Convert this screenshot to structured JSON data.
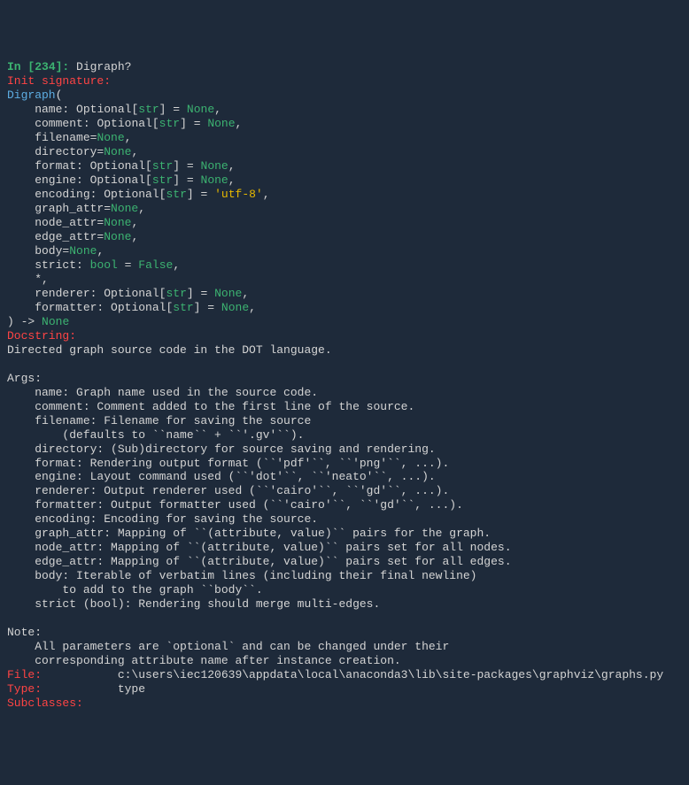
{
  "prompt": {
    "label": "In [",
    "number": "234",
    "close": "]: ",
    "query": "Digraph?"
  },
  "init_sig_label": "Init signature:",
  "signature": {
    "classname": "Digraph",
    "open": "(",
    "params": [
      {
        "raw": "    name: Optional[str] = None,"
      },
      {
        "raw": "    comment: Optional[str] = None,"
      },
      {
        "raw": "    filename=None,"
      },
      {
        "raw": "    directory=None,"
      },
      {
        "raw": "    format: Optional[str] = None,"
      },
      {
        "raw": "    engine: Optional[str] = None,"
      },
      {
        "raw": "    encoding: Optional[str] = 'utf-8',"
      },
      {
        "raw": "    graph_attr=None,"
      },
      {
        "raw": "    node_attr=None,"
      },
      {
        "raw": "    edge_attr=None,"
      },
      {
        "raw": "    body=None,"
      },
      {
        "raw": "    strict: bool = False,"
      },
      {
        "raw": "    *,"
      },
      {
        "raw": "    renderer: Optional[str] = None,"
      },
      {
        "raw": "    formatter: Optional[str] = None,"
      }
    ],
    "close": ") -> None"
  },
  "docstring_label": "Docstring:",
  "docstring_body": "Directed graph source code in the DOT language.\n\nArgs:\n    name: Graph name used in the source code.\n    comment: Comment added to the first line of the source.\n    filename: Filename for saving the source\n        (defaults to ``name`` + ``'.gv'``).\n    directory: (Sub)directory for source saving and rendering.\n    format: Rendering output format (``'pdf'``, ``'png'``, ...).\n    engine: Layout command used (``'dot'``, ``'neato'``, ...).\n    renderer: Output renderer used (``'cairo'``, ``'gd'``, ...).\n    formatter: Output formatter used (``'cairo'``, ``'gd'``, ...).\n    encoding: Encoding for saving the source.\n    graph_attr: Mapping of ``(attribute, value)`` pairs for the graph.\n    node_attr: Mapping of ``(attribute, value)`` pairs set for all nodes.\n    edge_attr: Mapping of ``(attribute, value)`` pairs set for all edges.\n    body: Iterable of verbatim lines (including their final newline)\n        to add to the graph ``body``.\n    strict (bool): Rendering should merge multi-edges.\n\nNote:\n    All parameters are `optional` and can be changed under their\n    corresponding attribute name after instance creation.",
  "file_label": "File:",
  "file_value": "           c:\\users\\iec120639\\appdata\\local\\anaconda3\\lib\\site-packages\\graphviz\\graphs.py",
  "type_label": "Type:",
  "type_value": "           type",
  "subclasses_label": "Subclasses:"
}
